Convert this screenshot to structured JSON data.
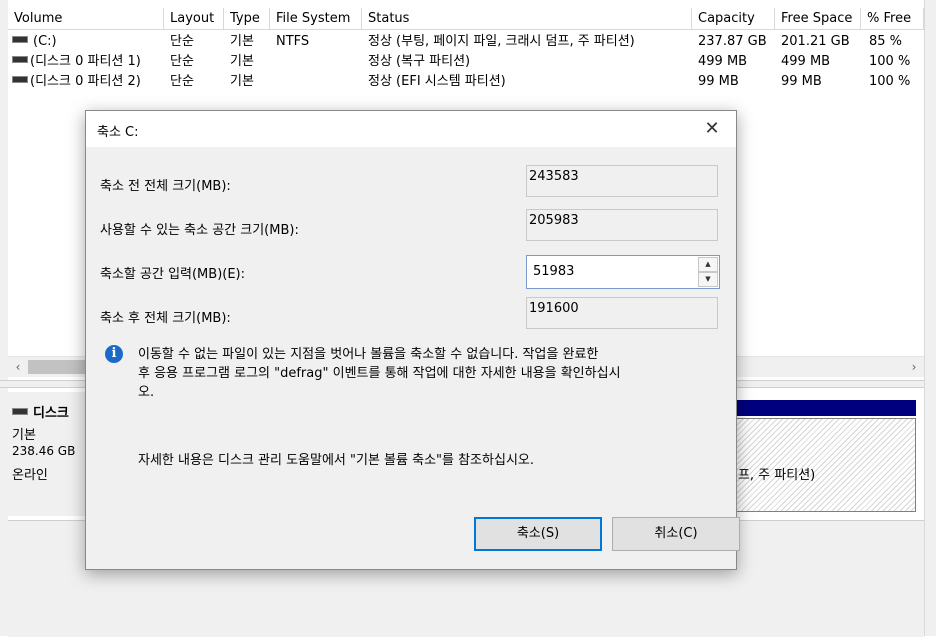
{
  "columns": [
    "Volume",
    "Layout",
    "Type",
    "File System",
    "Status",
    "Capacity",
    "Free Space",
    "% Free"
  ],
  "volumes": [
    {
      "volume": "(C:)",
      "layout": "단순",
      "type": "기본",
      "fs": "NTFS",
      "status": "정상 (부팅, 페이지 파일, 크래시 덤프, 주 파티션)",
      "capacity": "237.87 GB",
      "free": "201.21 GB",
      "pct": "85 %"
    },
    {
      "volume": "(디스크 0 파티션 1)",
      "layout": "단순",
      "type": "기본",
      "fs": "",
      "status": "정상 (복구 파티션)",
      "capacity": "499 MB",
      "free": "499 MB",
      "pct": "100 %"
    },
    {
      "volume": "(디스크 0 파티션 2)",
      "layout": "단순",
      "type": "기본",
      "fs": "",
      "status": "정상 (EFI 시스템 파티션)",
      "capacity": "99 MB",
      "free": "99 MB",
      "pct": "100 %"
    }
  ],
  "scroll": {
    "left_arrow": "‹",
    "right_arrow": "›"
  },
  "disk": {
    "name": "디스크",
    "type": "기본",
    "size": "238.46 GB",
    "state": "온라인",
    "partition_text": "덤프, 주 파티션)"
  },
  "dialog": {
    "title": "축소 C:",
    "close": "✕",
    "total_before_label": "축소 전 전체 크기(MB):",
    "total_before_value": "243583",
    "available_label": "사용할 수 있는 축소 공간 크기(MB):",
    "available_value": "205983",
    "shrink_label": "축소할 공간 입력(MB)(E):",
    "shrink_value": "51983",
    "total_after_label": "축소 후 전체 크기(MB):",
    "total_after_value": "191600",
    "info_icon": "i",
    "message_line1": "이동할 수 없는 파일이 있는 지점을 벗어나 볼륨을 축소할 수 없습니다. 작업을 완료한",
    "message_line2": "후 응용 프로그램 로그의 \"defrag\" 이벤트를 통해 작업에 대한 자세한 내용을 확인하십시",
    "message_line3": "오.",
    "help_text": "자세한 내용은 디스크 관리 도움말에서 \"기본 볼륨 축소\"를 참조하십시오.",
    "shrink_button": "축소(S)",
    "cancel_button": "취소(C)"
  }
}
